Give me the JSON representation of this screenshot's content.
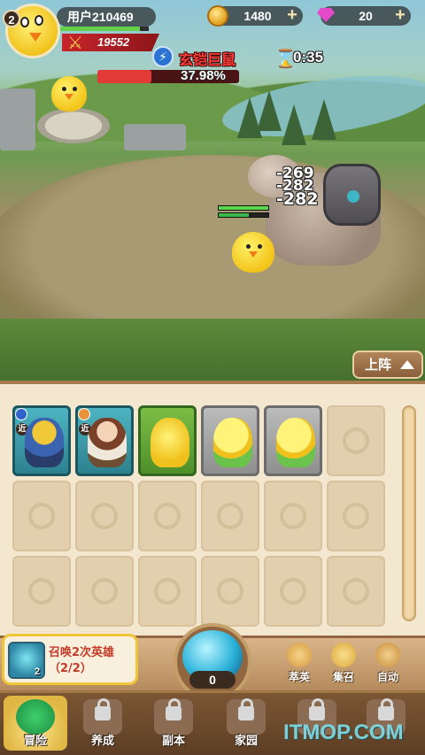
{
  "player": {
    "level": "2",
    "name": "用户210469",
    "exp_fraction": 0.9,
    "power": "19552"
  },
  "currency": {
    "coins": "1480",
    "gems": "20"
  },
  "boss": {
    "name": "玄铠巨鼠",
    "hp_percent_text": "37.98%",
    "hp_fraction": 0.3798,
    "timer": "0:35"
  },
  "damage": [
    "-269",
    "-282",
    "-282"
  ],
  "deploy_button": "上阵",
  "grid": {
    "rows": 3,
    "cols": 6,
    "heroes": [
      {
        "frame": "blue",
        "badge": "blue",
        "tag": "近",
        "figure": "warrior"
      },
      {
        "frame": "blue",
        "badge": "orange",
        "tag": "近",
        "figure": "girl"
      },
      {
        "frame": "green",
        "figure": "chick"
      },
      {
        "frame": "gray",
        "figure": "chick-green"
      },
      {
        "frame": "gray",
        "figure": "chick-green"
      }
    ]
  },
  "quest": {
    "count": "2",
    "text": "召唤2次英雄（2/2）"
  },
  "summon_orb": {
    "count": "0"
  },
  "actions": [
    {
      "label": "萃英",
      "icon": "swirl-icon"
    },
    {
      "label": "集召",
      "icon": "horn-icon"
    },
    {
      "label": "自动",
      "icon": "gear-icon"
    }
  ],
  "nav": [
    {
      "label": "冒险",
      "locked": false,
      "active": true
    },
    {
      "label": "养成",
      "locked": true
    },
    {
      "label": "副本",
      "locked": true
    },
    {
      "label": "家园",
      "locked": true
    },
    {
      "label": "",
      "locked": true
    },
    {
      "label": "",
      "locked": true
    }
  ],
  "watermark": "ITMOP.COM",
  "colors": {
    "boss_name": "#ff3b38",
    "hp_bar": "#e23a36",
    "quest_text": "#c43b2a",
    "active_nav": "#e0b744"
  }
}
